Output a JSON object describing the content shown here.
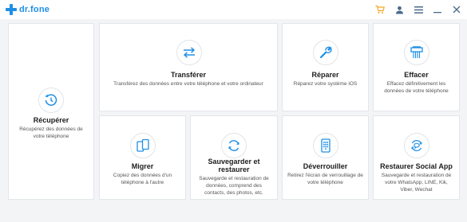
{
  "app": {
    "name": "dr.fone",
    "brand_color": "#1f8fe6",
    "accent_color": "#f5a623",
    "toolbar_icons": [
      "cart-icon",
      "user-icon",
      "menu-icon",
      "minimize-icon",
      "close-icon"
    ]
  },
  "tiles": {
    "recuperer": {
      "title": "Récupérer",
      "desc": "Récupérez des données de votre téléphone",
      "icon": "recover-icon"
    },
    "transferer": {
      "title": "Transférer",
      "desc": "Transférez des données entre votre téléphone et votre ordinateur",
      "icon": "transfer-icon"
    },
    "reparer": {
      "title": "Réparer",
      "desc": "Réparez votre système iOS",
      "icon": "repair-icon"
    },
    "effacer": {
      "title": "Effacer",
      "desc": "Effacez définitivement les données de votre téléphone",
      "icon": "erase-icon"
    },
    "migrer": {
      "title": "Migrer",
      "desc": "Copiez des données d'un téléphone à l'autre",
      "icon": "migrate-icon"
    },
    "sauvegarder": {
      "title": "Sauvegarder et restaurer",
      "desc": "Sauvegarde et restauration de données, comprend des contacts, des photos, etc.",
      "icon": "backup-restore-icon"
    },
    "deverrouiller": {
      "title": "Déverrouiller",
      "desc": "Retirez l'écran de verrouillage de votre téléphone",
      "icon": "unlock-icon"
    },
    "social": {
      "title": "Restaurer Social App",
      "desc": "Sauvegarde et restauration de votre WhatsApp, LINE, Kik, Viber, Wechat",
      "icon": "social-app-icon"
    }
  }
}
